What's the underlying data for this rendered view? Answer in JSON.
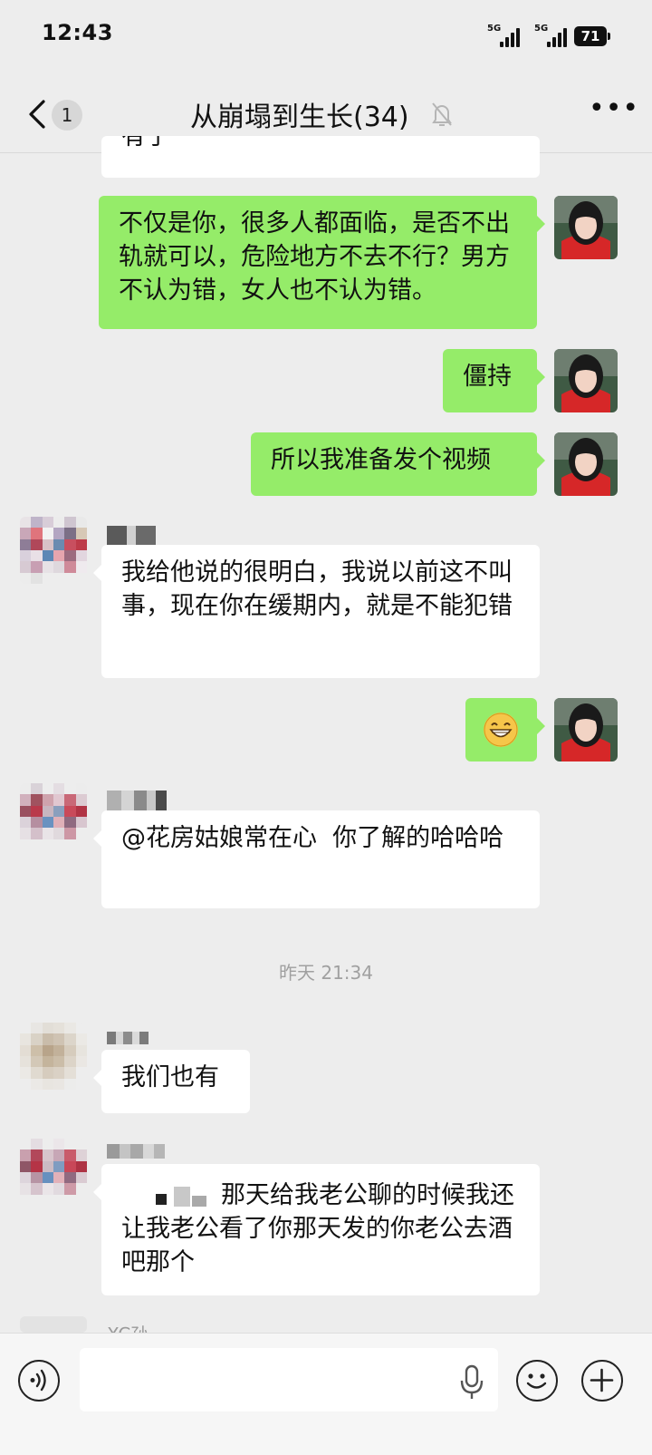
{
  "status_bar": {
    "time": "12:43",
    "network1": "5G",
    "network2": "5G",
    "battery": "71"
  },
  "header": {
    "unread_count": "1",
    "title": "从崩塌到生长(34)"
  },
  "messages": {
    "partial_top": "有了",
    "m1": "不仅是你，很多人都面临，是否不出轨就可以，危险地方不去不行？男方不认为错，女人也不认为错。",
    "m2": "僵持",
    "m3": "所以我准备发个视频",
    "m4": "我给他说的很明白，我说以前这不叫事，现在你在缓期内，就是不能犯错",
    "m5_emoji": "grinning-emoji",
    "m6": "@花房姑娘常在心  你了解的哈哈哈",
    "timestamp": "昨天 21:34",
    "m7": "我们也有",
    "m8": "那天给我老公聊的时候我还让我老公看了你那天发的你老公去酒吧那个",
    "next_sender": "XC孙"
  },
  "colors": {
    "outgoing": "#95ec69",
    "incoming": "#ffffff",
    "background": "#ededed"
  },
  "icons": [
    "back-icon",
    "mute-bell-icon",
    "more-icon",
    "voice-icon",
    "mic-icon",
    "emoji-icon",
    "plus-icon"
  ]
}
